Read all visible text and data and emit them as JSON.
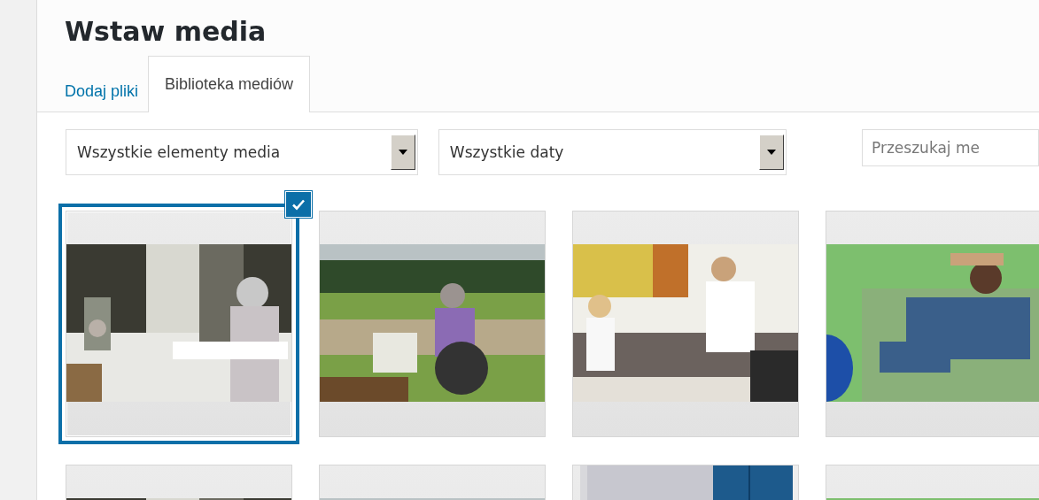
{
  "title": "Wstaw media",
  "tabs": [
    {
      "label": "Dodaj pliki",
      "selected": false
    },
    {
      "label": "Biblioteka mediów",
      "selected": true
    }
  ],
  "filters": [
    {
      "value": "Wszystkie elementy media"
    },
    {
      "value": "Wszystkie daty"
    }
  ],
  "search": {
    "placeholder": "Przeszukaj me"
  },
  "items": [
    {
      "kind": "landscape",
      "selected": true
    },
    {
      "kind": "landscape",
      "selected": false
    },
    {
      "kind": "landscape",
      "selected": false
    },
    {
      "kind": "landscape",
      "selected": false
    },
    {
      "kind": "landscape",
      "selected": false
    },
    {
      "kind": "landscape",
      "selected": false
    },
    {
      "kind": "portrait",
      "selected": false
    },
    {
      "kind": "landscape",
      "selected": false
    }
  ]
}
